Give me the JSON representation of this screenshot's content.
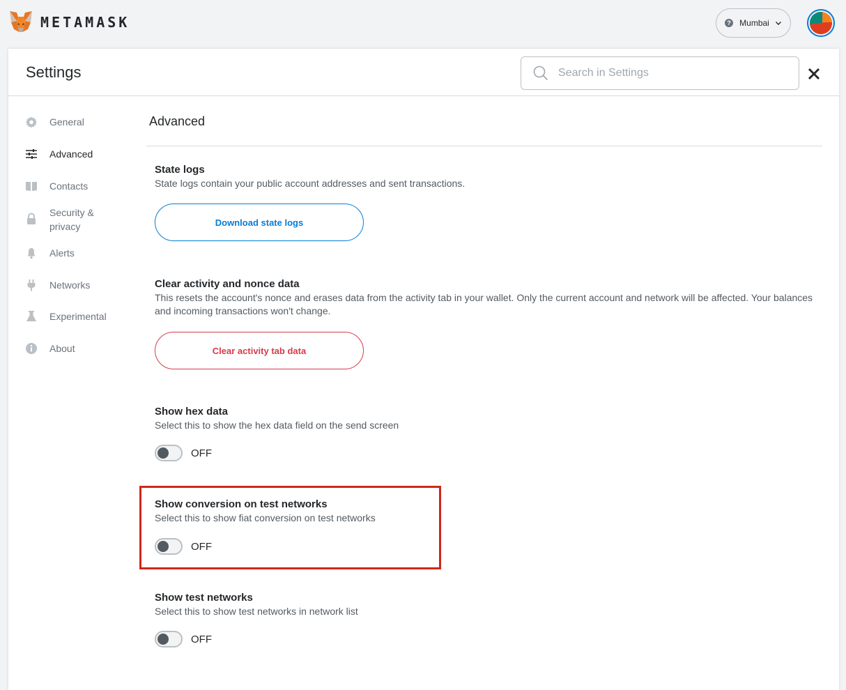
{
  "app": {
    "brand": "METAMASK",
    "network": "Mumbai",
    "network_icon_glyph": "?"
  },
  "header": {
    "title": "Settings",
    "search_placeholder": "Search in Settings"
  },
  "sidebar": {
    "items": [
      {
        "label": "General",
        "icon": "gear-icon",
        "active": false
      },
      {
        "label": "Advanced",
        "icon": "sliders-icon",
        "active": true
      },
      {
        "label": "Contacts",
        "icon": "book-icon",
        "active": false
      },
      {
        "label": "Security &\nprivacy",
        "icon": "lock-icon",
        "active": false
      },
      {
        "label": "Alerts",
        "icon": "bell-icon",
        "active": false
      },
      {
        "label": "Networks",
        "icon": "plug-icon",
        "active": false
      },
      {
        "label": "Experimental",
        "icon": "flask-icon",
        "active": false
      },
      {
        "label": "About",
        "icon": "info-icon",
        "active": false
      }
    ]
  },
  "content": {
    "section_title": "Advanced",
    "state_logs": {
      "label": "State logs",
      "desc": "State logs contain your public account addresses and sent transactions.",
      "button": "Download state logs"
    },
    "clear_activity": {
      "label": "Clear activity and nonce data",
      "desc": "This resets the account's nonce and erases data from the activity tab in your wallet. Only the current account and network will be affected. Your balances and incoming transactions won't change.",
      "button": "Clear activity tab data"
    },
    "hex_data": {
      "label": "Show hex data",
      "desc": "Select this to show the hex data field on the send screen",
      "state": "OFF"
    },
    "conversion_test": {
      "label": "Show conversion on test networks",
      "desc": "Select this to show fiat conversion on test networks",
      "state": "OFF"
    },
    "test_networks": {
      "label": "Show test networks",
      "desc": "Select this to show test networks in network list",
      "state": "OFF"
    }
  },
  "colors": {
    "accent": "#037dd6",
    "danger": "#d73a49",
    "highlight": "#d0271b"
  }
}
